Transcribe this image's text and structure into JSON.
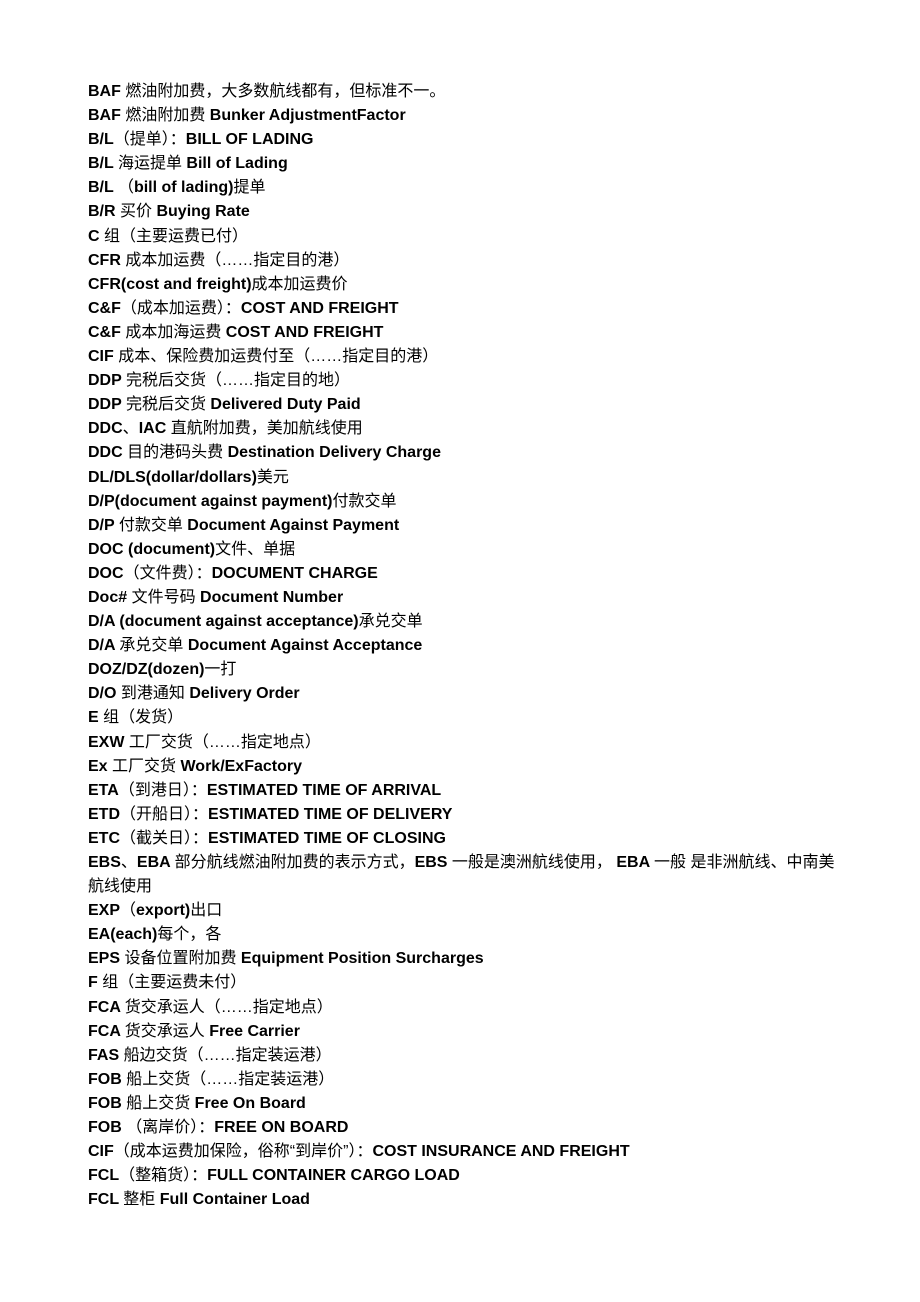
{
  "document": {
    "lines": [
      "BAF 燃油附加费，大多数航线都有，但标准不一。",
      "BAF 燃油附加费 Bunker AdjustmentFactor",
      "B/L（提单）：BILL OF LADING",
      "B/L 海运提单 Bill of Lading",
      "B/L （bill of lading)提单",
      "B/R 买价 Buying Rate",
      "C 组（主要运费已付）",
      "CFR 成本加运费（……指定目的港）",
      "CFR(cost and freight)成本加运费价",
      "C&F（成本加运费）：COST AND FREIGHT",
      "C&F 成本加海运费 COST AND FREIGHT",
      "CIF 成本、保险费加运费付至（……指定目的港）",
      "DDP 完税后交货（……指定目的地）",
      "DDP 完税后交货 Delivered Duty Paid",
      "DDC、IAC 直航附加费，美加航线使用",
      "DDC 目的港码头费 Destination Delivery Charge",
      "DL/DLS(dollar/dollars)美元",
      "D/P(document against payment)付款交单",
      "D/P 付款交单 Document Against Payment",
      "DOC (document)文件、单据",
      "DOC（文件费）：DOCUMENT CHARGE",
      "Doc# 文件号码 Document Number",
      "D/A (document against acceptance)承兑交单",
      "D/A 承兑交单 Document Against Acceptance",
      "DOZ/DZ(dozen)一打",
      "D/O 到港通知 Delivery Order",
      "E 组（发货）",
      "EXW 工厂交货（……指定地点）",
      "Ex 工厂交货 Work/ExFactory",
      "ETA（到港日）：ESTIMATED TIME OF ARRIVAL",
      "ETD（开船日）：ESTIMATED TIME OF DELIVERY",
      "ETC（截关日）：ESTIMATED TIME OF CLOSING",
      "EBS、EBA 部分航线燃油附加费的表示方式，EBS 一般是澳洲航线使用， EBA 一般 是非洲航线、中南美航线使用",
      "EXP（export)出口",
      "EA(each)每个，各",
      "EPS 设备位置附加费 Equipment Position Surcharges",
      "F 组（主要运费未付）",
      "FCA 货交承运人（……指定地点）",
      "FCA 货交承运人 Free Carrier",
      "FAS 船边交货（……指定装运港）",
      "FOB 船上交货（……指定装运港）",
      "FOB 船上交货 Free On Board",
      "FOB （离岸价）：FREE ON BOARD",
      "CIF（成本运费加保险，俗称“到岸价”）：COST INSURANCE AND FREIGHT",
      "FCL（整箱货）：FULL CONTAINER CARGO LOAD",
      "FCL 整柜 Full Container Load"
    ]
  }
}
